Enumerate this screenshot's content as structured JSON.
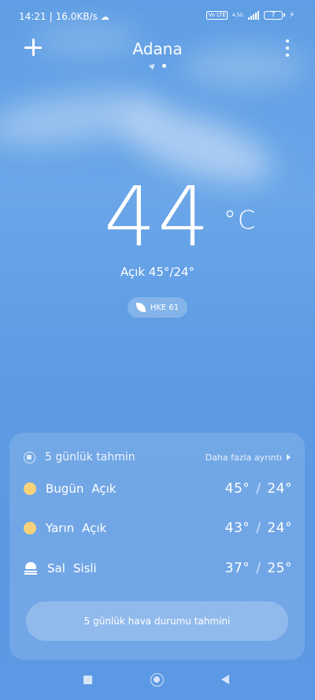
{
  "status_bar": {
    "time": "14:21",
    "network_speed": "16.0KB/s",
    "weather_icon": "cloud-icon",
    "vo_badge": "Vo LTE",
    "network_type": "4.5G",
    "battery": "7",
    "charging_icon": "bolt-icon"
  },
  "header": {
    "city": "Adana",
    "add_icon": "plus-icon",
    "menu_icon": "more-vertical-icon",
    "page_indicator": [
      "location-arrow-icon",
      "dot"
    ]
  },
  "current": {
    "temperature": "44",
    "unit": "°C",
    "condition": "Açık 45°/24°",
    "aqi_label": "HKE 61",
    "aqi_icon": "leaf-icon"
  },
  "forecast": {
    "title": "5 günlük tahmin",
    "more_link": "Daha fazla ayrıntı",
    "days": [
      {
        "label": "Bugün",
        "condition": "Açık",
        "icon": "sun-icon",
        "high": "45°",
        "low": "24°"
      },
      {
        "label": "Yarın",
        "condition": "Açık",
        "icon": "sun-icon",
        "high": "43°",
        "low": "24°"
      },
      {
        "label": "Sal",
        "condition": "Sisli",
        "icon": "fog-icon",
        "high": "37°",
        "low": "25°"
      }
    ],
    "cta": "5 günlük hava durumu tahmini"
  },
  "colors": {
    "sky": "#5f9ee4",
    "sun": "#f7d27a"
  }
}
